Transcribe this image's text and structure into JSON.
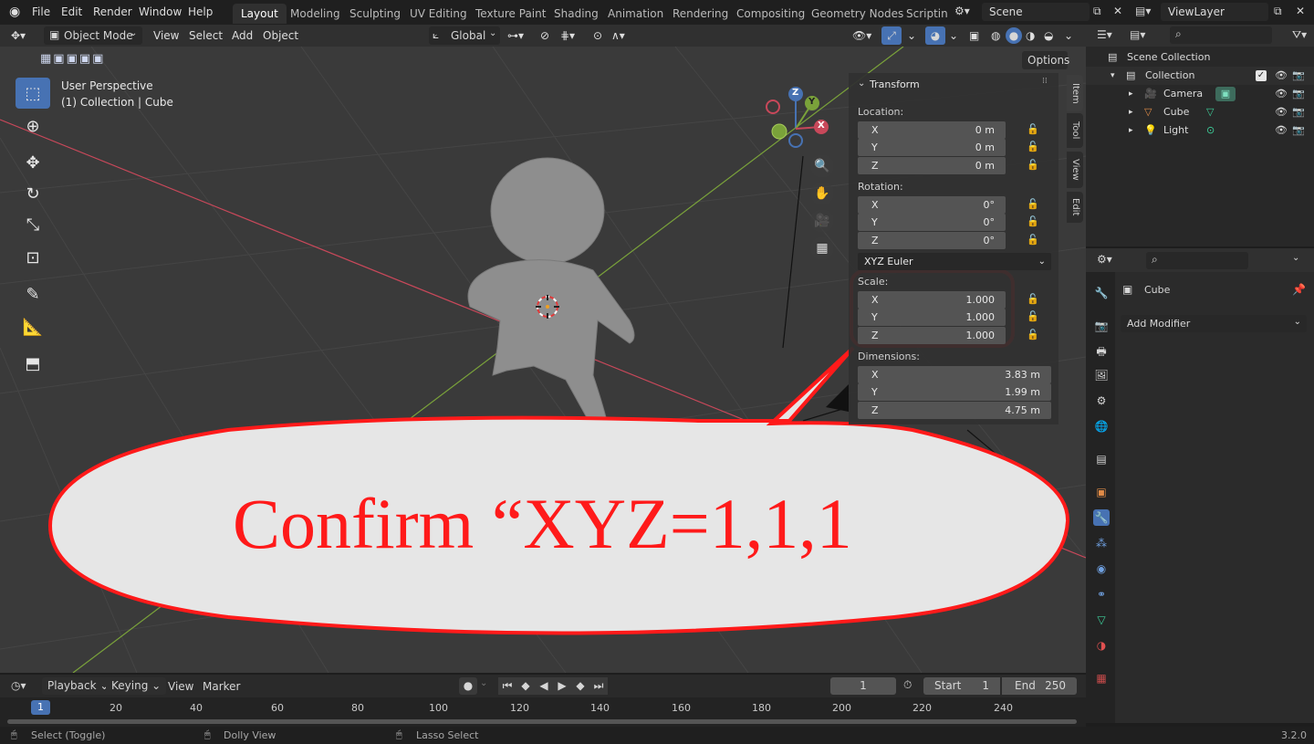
{
  "topbar": {
    "menus": [
      "File",
      "Edit",
      "Render",
      "Window",
      "Help"
    ],
    "workspaces": [
      "Layout",
      "Modeling",
      "Sculpting",
      "UV Editing",
      "Texture Paint",
      "Shading",
      "Animation",
      "Rendering",
      "Compositing",
      "Geometry Nodes",
      "Scripting"
    ],
    "active_workspace": "Layout",
    "scene": "Scene",
    "view_layer": "ViewLayer"
  },
  "viewport_header": {
    "mode": "Object Mode",
    "menus": [
      "View",
      "Select",
      "Add",
      "Object"
    ],
    "transform_orientation": "Global",
    "options": "Options"
  },
  "viewport": {
    "perspective": "User Perspective",
    "context": "(1) Collection | Cube",
    "gizmo": {
      "x": "X",
      "y": "Y",
      "z": "Z"
    }
  },
  "npanel": {
    "title": "Transform",
    "location_label": "Location:",
    "location": [
      {
        "axis": "X",
        "value": "0 m"
      },
      {
        "axis": "Y",
        "value": "0 m"
      },
      {
        "axis": "Z",
        "value": "0 m"
      }
    ],
    "rotation_label": "Rotation:",
    "rotation": [
      {
        "axis": "X",
        "value": "0°"
      },
      {
        "axis": "Y",
        "value": "0°"
      },
      {
        "axis": "Z",
        "value": "0°"
      }
    ],
    "rotation_mode": "XYZ Euler",
    "scale_label": "Scale:",
    "scale": [
      {
        "axis": "X",
        "value": "1.000"
      },
      {
        "axis": "Y",
        "value": "1.000"
      },
      {
        "axis": "Z",
        "value": "1.000"
      }
    ],
    "dimensions_label": "Dimensions:",
    "dimensions": [
      {
        "axis": "X",
        "value": "3.83 m"
      },
      {
        "axis": "Y",
        "value": "1.99 m"
      },
      {
        "axis": "Z",
        "value": "4.75 m"
      }
    ],
    "tabs": [
      "Item",
      "Tool",
      "View",
      "Edit"
    ]
  },
  "callout": {
    "text": "Confirm “XYZ=1,1,1",
    "color": "#ff1a1a"
  },
  "outliner": {
    "root": "Scene Collection",
    "collection": "Collection",
    "items": [
      "Camera",
      "Cube",
      "Light"
    ]
  },
  "properties": {
    "object_name": "Cube",
    "add_modifier": "Add Modifier"
  },
  "timeline": {
    "menus": [
      "Playback",
      "Keying",
      "View",
      "Marker"
    ],
    "current_frame": "1",
    "start_label": "Start",
    "start": "1",
    "end_label": "End",
    "end": "250",
    "ruler_marks": [
      "1",
      "20",
      "40",
      "60",
      "80",
      "100",
      "120",
      "140",
      "160",
      "180",
      "200",
      "220",
      "240"
    ]
  },
  "status_bar": {
    "left": "Select (Toggle)",
    "middle": "Dolly View",
    "right": "Lasso Select",
    "version": "3.2.0"
  },
  "colors": {
    "accent_blue": "#4772b3",
    "highlight_red": "#ff1a1a",
    "axis_red": "#c8485a",
    "axis_green": "#7aa23a"
  }
}
